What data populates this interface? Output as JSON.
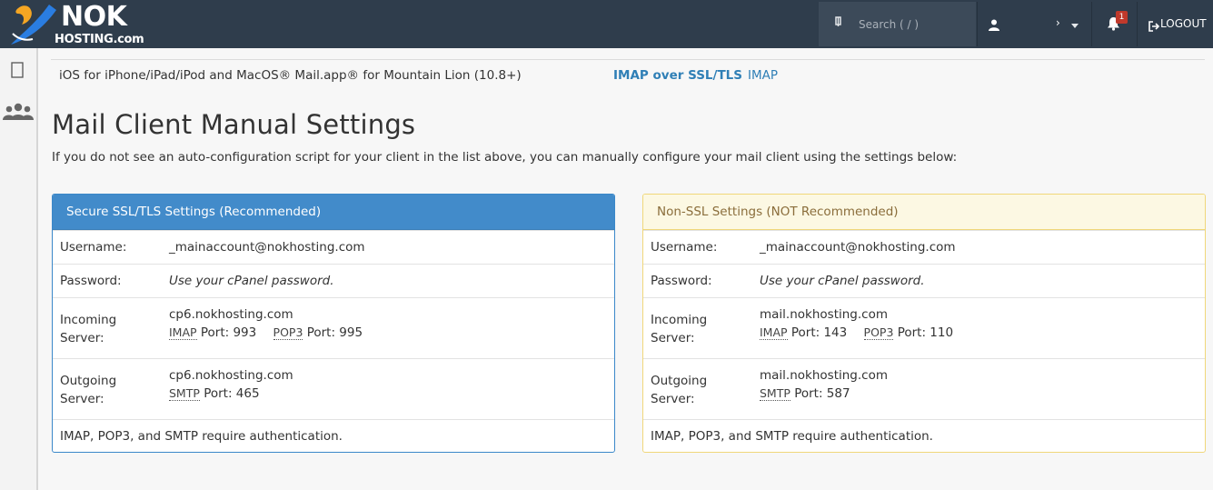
{
  "header": {
    "logo_main": "NOK",
    "logo_sub": "HOSTING.com",
    "search_placeholder": "Search ( / )",
    "user_name": "›",
    "notifications_count": "1",
    "logout_label": "LOGOUT"
  },
  "sidebar": {
    "items": [
      {
        "icon": "page-icon"
      },
      {
        "icon": "users-icon"
      }
    ]
  },
  "clients": {
    "row": {
      "name": "iOS for iPhone/iPad/iPod and MacOS® Mail.app® for Mountain Lion (10.8+)",
      "link_secure": "IMAP over SSL/TLS",
      "link_plain": "IMAP"
    }
  },
  "manual": {
    "title": "Mail Client Manual Settings",
    "intro": "If you do not see an auto-configuration script for your client in the list above, you can manually configure your mail client using the settings below:"
  },
  "ssl_panel": {
    "heading": "Secure SSL/TLS Settings (Recommended)",
    "username_label": "Username:",
    "username": "_mainaccount@nokhosting.com",
    "password_label": "Password:",
    "password": "Use your cPanel password.",
    "incoming_label": "Incoming Server:",
    "incoming_host": "cp6.nokhosting.com",
    "imap_abbr": "IMAP",
    "imap_port": "Port: 993",
    "pop3_abbr": "POP3",
    "pop3_port": "Port: 995",
    "outgoing_label": "Outgoing Server:",
    "outgoing_host": "cp6.nokhosting.com",
    "smtp_abbr": "SMTP",
    "smtp_port": "Port: 465",
    "auth_note": "IMAP, POP3, and SMTP require authentication."
  },
  "nonssl_panel": {
    "heading": "Non-SSL Settings (NOT Recommended)",
    "username_label": "Username:",
    "username": "_mainaccount@nokhosting.com",
    "password_label": "Password:",
    "password": "Use your cPanel password.",
    "incoming_label": "Incoming Server:",
    "incoming_host": "mail.nokhosting.com",
    "imap_abbr": "IMAP",
    "imap_port": "Port: 143",
    "pop3_abbr": "POP3",
    "pop3_port": "Port: 110",
    "outgoing_label": "Outgoing Server:",
    "outgoing_host": "mail.nokhosting.com",
    "smtp_abbr": "SMTP",
    "smtp_port": "Port: 587",
    "auth_note": "IMAP, POP3, and SMTP require authentication."
  },
  "colors": {
    "topbar": "#2f3d4c",
    "ssl_accent": "#428bca",
    "warning_bg": "#fcf8e3",
    "warning_border": "#f0d77a",
    "link": "#2f7fb6",
    "badge": "#c0392b",
    "logo_bird": "#f5a623",
    "logo_swoosh": "#2a7de1"
  }
}
